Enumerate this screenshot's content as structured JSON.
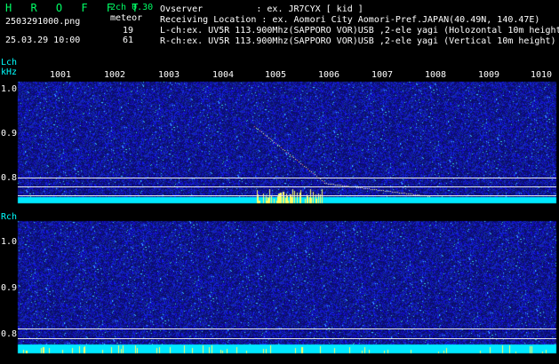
{
  "header": {
    "title": "H R O F F T",
    "version": "2ch 0.30",
    "mode": "meteor",
    "filename": "2503291000.png",
    "datetime": "25.03.29 10:00",
    "lch_count": "19",
    "rch_count": "61",
    "info_lines": [
      "Ovserver          : ex. JR7CYX [ kid ]",
      "Receiving Location : ex. Aomori City Aomori-Pref.JAPAN(40.49N, 140.47E)",
      "L-ch:ex. UV5R 113.900Mhz(SAPPORO VOR)USB ,2-ele yagi (Holozontal 10m height",
      "R-ch:ex. UV5R 113.900Mhz(SAPPORO VOR)USB ,2-ele yagi (Vertical 10m height)"
    ]
  },
  "lch": {
    "label": "Lch",
    "unit": "kHz",
    "time_ticks": [
      "1001",
      "1002",
      "1003",
      "1004",
      "1005",
      "1006",
      "1007",
      "1008",
      "1009",
      "1010"
    ],
    "freq_ticks": [
      "1.0",
      "0.9",
      "0.8"
    ]
  },
  "rch": {
    "label": "Rch",
    "freq_ticks": [
      "1.0",
      "0.9",
      "0.8"
    ]
  },
  "colors": {
    "background": "#000000",
    "noise": "#1c2fd0",
    "baseline": "#00e8ff",
    "meteor": "#ffff66",
    "grid": "#e8e8e8"
  }
}
